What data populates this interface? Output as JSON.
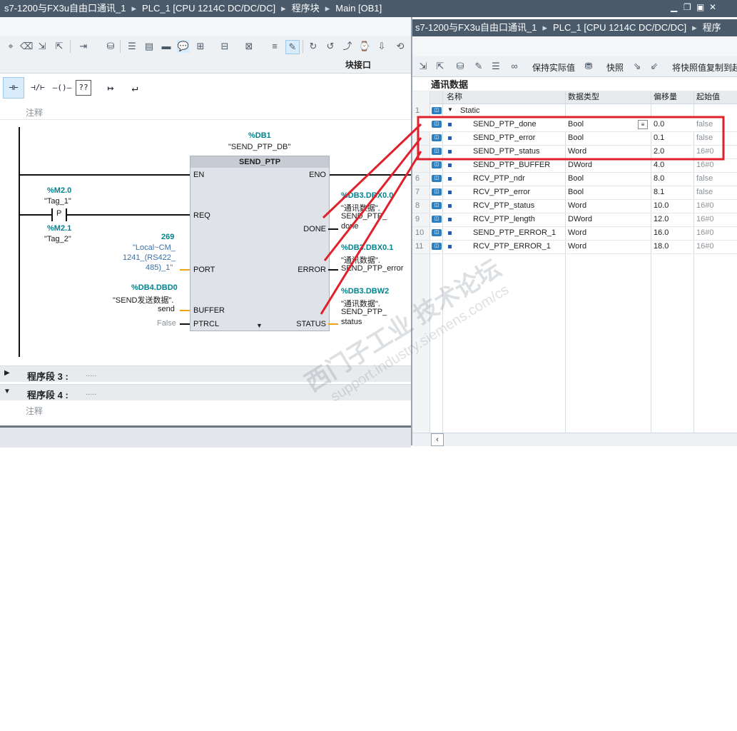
{
  "left_title": {
    "project": "s7-1200与FX3u自由口通讯_1",
    "plc": "PLC_1 [CPU 1214C DC/DC/DC]",
    "folder": "程序块",
    "block": "Main [OB1]"
  },
  "right_title": {
    "project": "s7-1200与FX3u自由口通讯_1",
    "plc": "PLC_1 [CPU 1214C DC/DC/DC]",
    "folder": "程序"
  },
  "left_toolbar": {
    "interface_label": "块接口"
  },
  "palette": [
    "⊣⊢",
    "⊣/⊢",
    "–()–",
    "??",
    "↦",
    "↵"
  ],
  "network": {
    "comment_label": "注释",
    "instance_address": "%DB1",
    "instance_name": "\"SEND_PTP_DB\"",
    "block_name": "SEND_PTP",
    "pins_in": [
      "EN",
      "REQ",
      "PORT",
      "BUFFER",
      "PTRCL"
    ],
    "pins_out": [
      "ENO",
      "DONE",
      "ERROR",
      "STATUS"
    ],
    "req_contact": {
      "addr1": "%M2.0",
      "tag1": "\"Tag_1\"",
      "symbol": "P",
      "addr2": "%M2.1",
      "tag2": "\"Tag_2\""
    },
    "port": {
      "value": "269",
      "line1": "\"Local~CM_",
      "line2": "1241_(RS422_",
      "line3": "485)_1\""
    },
    "buffer": {
      "addr": "%DB4.DBD0",
      "line1": "\"SEND发送数据\".",
      "line2": "send"
    },
    "ptrcl": {
      "value": "False"
    },
    "done_out": {
      "addr": "%DB3.DBX0.0",
      "line1": "\"通讯数据\".",
      "line2": "SEND_PTP_",
      "line3": "done"
    },
    "error_out": {
      "addr": "%DB3.DBX0.1",
      "line1": "\"通讯数据\".",
      "line2": "SEND_PTP_error"
    },
    "status_out": {
      "addr": "%DB3.DBW2",
      "line1": "\"通讯数据\".",
      "line2": "SEND_PTP_",
      "line3": "status"
    }
  },
  "networks": [
    {
      "title": "程序段 3 :",
      "desc": "....."
    },
    {
      "title": "程序段 4 :",
      "desc": "....."
    }
  ],
  "network4_comment": "注释",
  "right_toolbar": {
    "keep_actual": "保持实际值",
    "snapshot": "快照",
    "copy_snapshot": "将快照值复制到起"
  },
  "db": {
    "title": "通讯数据",
    "headers": [
      "名称",
      "数据类型",
      "偏移量",
      "起始值"
    ],
    "group": {
      "num": "1",
      "name": "Static"
    },
    "rows": [
      {
        "num": "",
        "name": "SEND_PTP_done",
        "type": "Bool",
        "offset": "0.0",
        "start": "false"
      },
      {
        "num": "",
        "name": "SEND_PTP_error",
        "type": "Bool",
        "offset": "0.1",
        "start": "false"
      },
      {
        "num": "",
        "name": "SEND_PTP_status",
        "type": "Word",
        "offset": "2.0",
        "start": "16#0"
      },
      {
        "num": "",
        "name": "SEND_PTP_BUFFER",
        "type": "DWord",
        "offset": "4.0",
        "start": "16#0"
      },
      {
        "num": "6",
        "name": "RCV_PTP_ndr",
        "type": "Bool",
        "offset": "8.0",
        "start": "false"
      },
      {
        "num": "7",
        "name": "RCV_PTP_error",
        "type": "Bool",
        "offset": "8.1",
        "start": "false"
      },
      {
        "num": "8",
        "name": "RCV_PTP_status",
        "type": "Word",
        "offset": "10.0",
        "start": "16#0"
      },
      {
        "num": "9",
        "name": "RCV_PTP_length",
        "type": "DWord",
        "offset": "12.0",
        "start": "16#0"
      },
      {
        "num": "10",
        "name": "SEND_PTP_ERROR_1",
        "type": "Word",
        "offset": "16.0",
        "start": "16#0"
      },
      {
        "num": "11",
        "name": "RCV_PTP_ERROR_1",
        "type": "Word",
        "offset": "18.0",
        "start": "16#0"
      }
    ]
  },
  "watermark": {
    "line1": "西门子工业  技术论坛",
    "line2": "support.industry.siemens.com/cs"
  },
  "colors": {
    "titlebar": "#4a5a6a",
    "highlight": "#e0202a",
    "teal": "#00838f",
    "orange": "#f0a30a"
  }
}
